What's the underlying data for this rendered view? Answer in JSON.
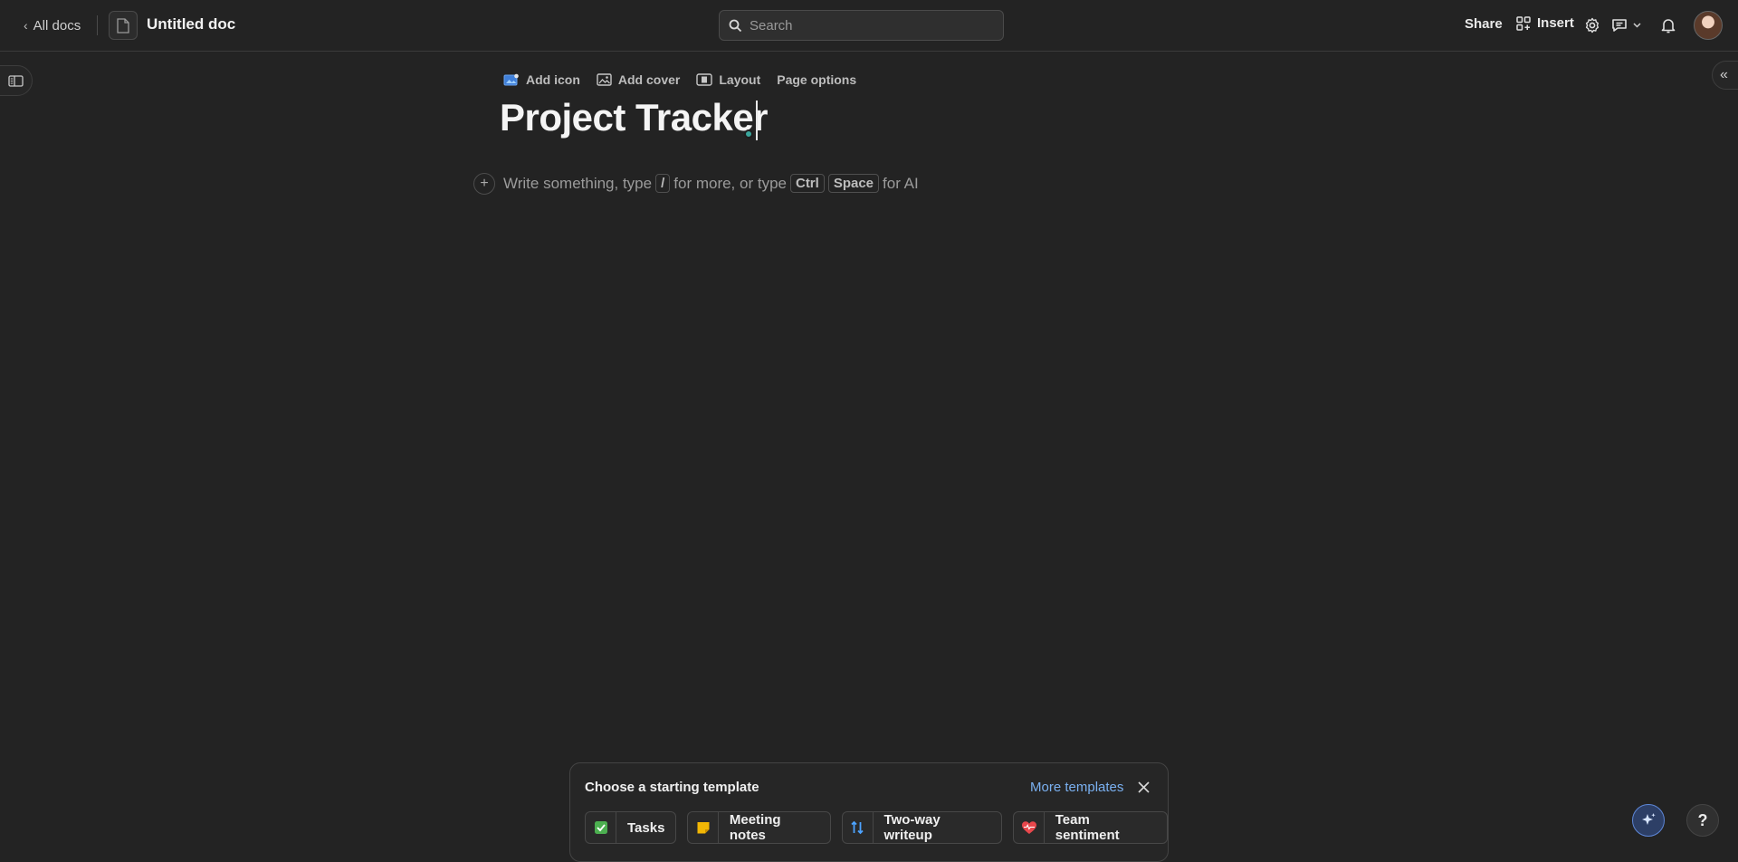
{
  "topbar": {
    "back_label": "All docs",
    "doc_title": "Untitled doc",
    "search_placeholder": "Search",
    "share_label": "Share",
    "insert_label": "Insert"
  },
  "page": {
    "options": {
      "add_icon": "Add icon",
      "add_cover": "Add cover",
      "layout": "Layout",
      "page_options": "Page options"
    },
    "title": "Project Tracker",
    "placeholder": {
      "part1": "Write something, type",
      "slash_key": "/",
      "part2": "for more, or type",
      "ctrl_key": "Ctrl",
      "space_key": "Space",
      "part3": "for AI"
    }
  },
  "templates": {
    "heading": "Choose a starting template",
    "more_link": "More templates",
    "items": [
      {
        "label": "Tasks",
        "icon": "checkbox-icon"
      },
      {
        "label": "Meeting notes",
        "icon": "sticky-note-icon"
      },
      {
        "label": "Two-way writeup",
        "icon": "arrows-updown-icon"
      },
      {
        "label": "Team sentiment",
        "icon": "heart-pulse-icon"
      }
    ]
  },
  "help_label": "?",
  "colors": {
    "background": "#232323",
    "accent_link": "#7ab0f0",
    "presence": "#3aa59b"
  }
}
